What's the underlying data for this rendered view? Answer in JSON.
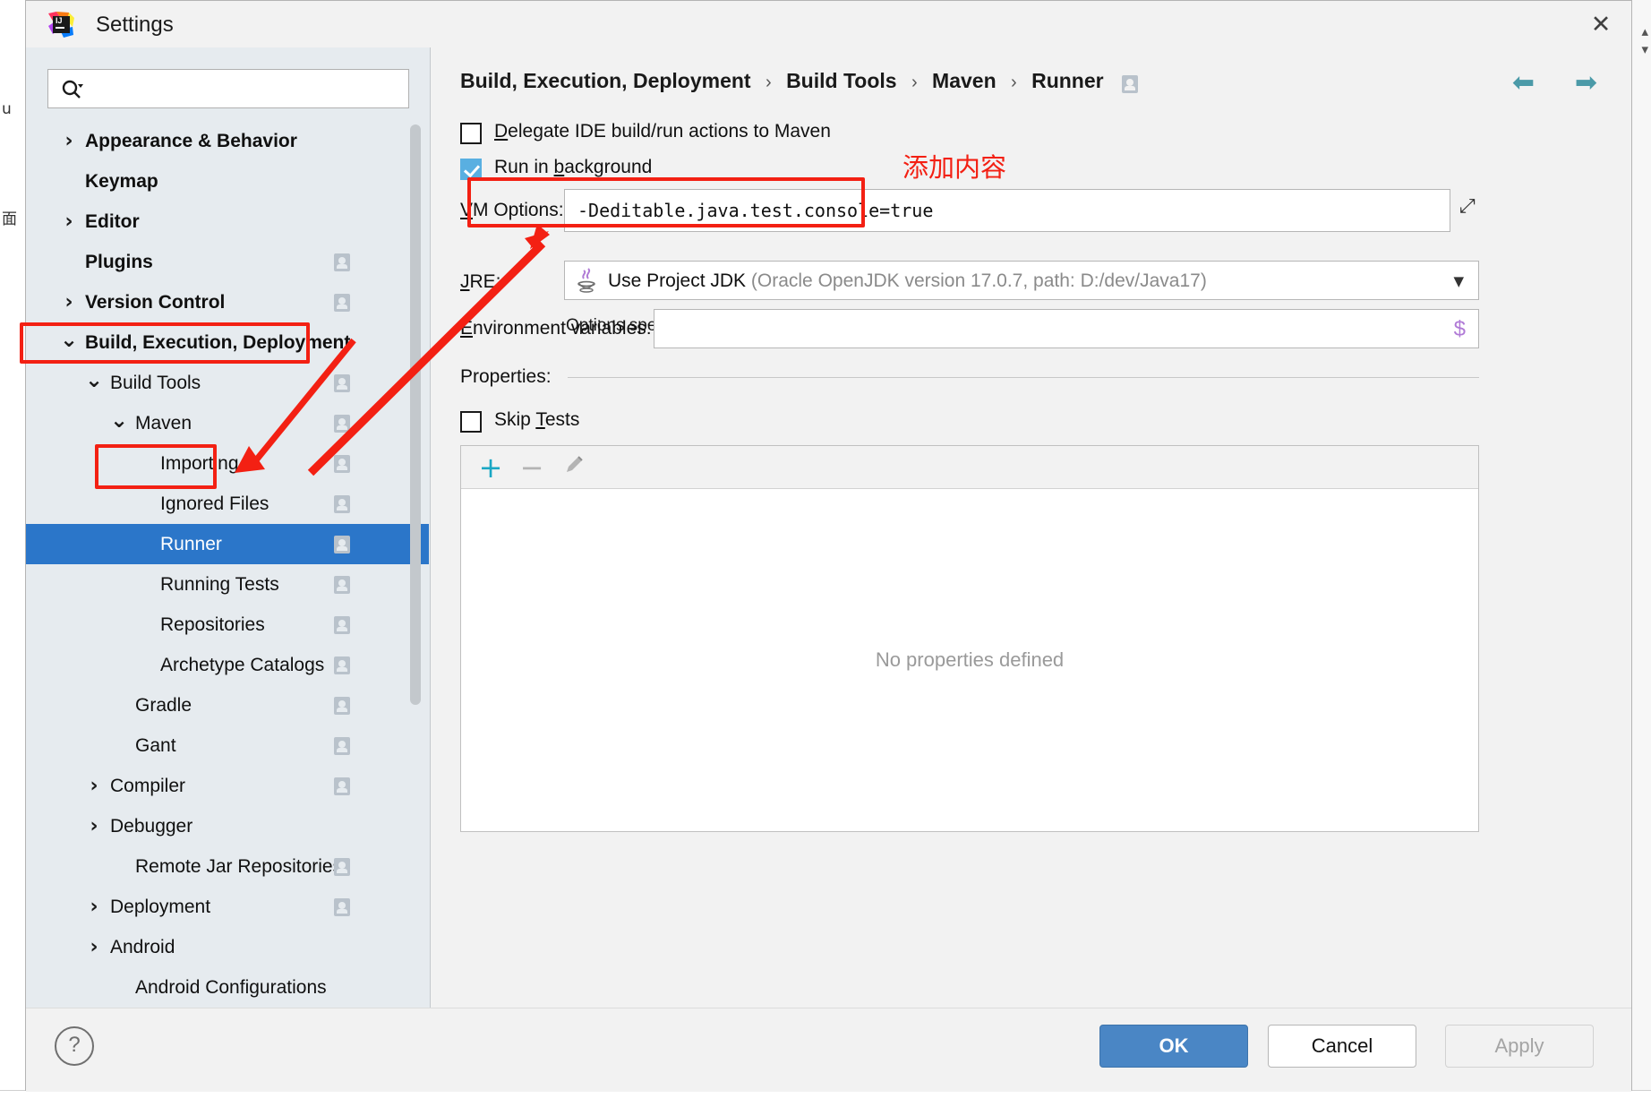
{
  "window": {
    "title": "Settings",
    "logo_icon": "intellij-idea-logo",
    "close_icon": "close-icon"
  },
  "sidebar": {
    "search": {
      "placeholder": "",
      "value": "",
      "icon": "search-icon"
    },
    "items": [
      {
        "label": "Appearance & Behavior",
        "indent": 0,
        "twisty": "collapsed",
        "bold": true,
        "badge": false,
        "selected": false
      },
      {
        "label": "Keymap",
        "indent": 0,
        "twisty": "none",
        "bold": true,
        "badge": false,
        "selected": false
      },
      {
        "label": "Editor",
        "indent": 0,
        "twisty": "collapsed",
        "bold": true,
        "badge": false,
        "selected": false
      },
      {
        "label": "Plugins",
        "indent": 0,
        "twisty": "none",
        "bold": true,
        "badge": true,
        "selected": false
      },
      {
        "label": "Version Control",
        "indent": 0,
        "twisty": "collapsed",
        "bold": true,
        "badge": true,
        "selected": false
      },
      {
        "label": "Build, Execution, Deployment",
        "indent": 0,
        "twisty": "expanded",
        "bold": true,
        "badge": false,
        "selected": false
      },
      {
        "label": "Build Tools",
        "indent": 1,
        "twisty": "expanded",
        "bold": false,
        "badge": true,
        "selected": false
      },
      {
        "label": "Maven",
        "indent": 2,
        "twisty": "expanded",
        "bold": false,
        "badge": true,
        "selected": false
      },
      {
        "label": "Importing",
        "indent": 3,
        "twisty": "none",
        "bold": false,
        "badge": true,
        "selected": false
      },
      {
        "label": "Ignored Files",
        "indent": 3,
        "twisty": "none",
        "bold": false,
        "badge": true,
        "selected": false
      },
      {
        "label": "Runner",
        "indent": 3,
        "twisty": "none",
        "bold": false,
        "badge": true,
        "selected": true
      },
      {
        "label": "Running Tests",
        "indent": 3,
        "twisty": "none",
        "bold": false,
        "badge": true,
        "selected": false
      },
      {
        "label": "Repositories",
        "indent": 3,
        "twisty": "none",
        "bold": false,
        "badge": true,
        "selected": false
      },
      {
        "label": "Archetype Catalogs",
        "indent": 3,
        "twisty": "none",
        "bold": false,
        "badge": true,
        "selected": false
      },
      {
        "label": "Gradle",
        "indent": 2,
        "twisty": "none",
        "bold": false,
        "badge": true,
        "selected": false
      },
      {
        "label": "Gant",
        "indent": 2,
        "twisty": "none",
        "bold": false,
        "badge": true,
        "selected": false
      },
      {
        "label": "Compiler",
        "indent": 1,
        "twisty": "collapsed",
        "bold": false,
        "badge": true,
        "selected": false
      },
      {
        "label": "Debugger",
        "indent": 1,
        "twisty": "collapsed",
        "bold": false,
        "badge": false,
        "selected": false
      },
      {
        "label": "Remote Jar Repositories",
        "indent": 2,
        "twisty": "none",
        "bold": false,
        "badge": true,
        "selected": false
      },
      {
        "label": "Deployment",
        "indent": 1,
        "twisty": "collapsed",
        "bold": false,
        "badge": true,
        "selected": false
      },
      {
        "label": "Android",
        "indent": 1,
        "twisty": "collapsed",
        "bold": false,
        "badge": false,
        "selected": false
      },
      {
        "label": "Android Configurations",
        "indent": 2,
        "twisty": "none",
        "bold": false,
        "badge": false,
        "selected": false
      }
    ]
  },
  "breadcrumb": {
    "parts": [
      "Build, Execution, Deployment",
      "Build Tools",
      "Maven",
      "Runner"
    ],
    "separator": "›",
    "badge_icon": "project-scope-badge-icon",
    "back_icon": "arrow-left-icon",
    "forward_icon": "arrow-right-icon"
  },
  "form": {
    "delegate": {
      "label": "Delegate IDE build/run actions to Maven",
      "checked": false
    },
    "run_in_background": {
      "label": "Run in background",
      "checked": true
    },
    "vm_options": {
      "label": "VM Options:",
      "value": "-Deditable.java.test.console=true",
      "expand_icon": "expand-editor-icon"
    },
    "vm_hint": "Options specified in this field override the ones in .mvn/jvm.config files",
    "jre": {
      "label": "JRE:",
      "icon": "java-duke-icon",
      "value": "Use Project JDK",
      "detail": "(Oracle OpenJDK version 17.0.7, path: D:/dev/Java17)",
      "chevron_icon": "chevron-down-icon"
    },
    "env_vars": {
      "label": "Environment variables:",
      "value": "",
      "macro_icon": "insert-macro-icon",
      "macro_glyph": "$"
    },
    "properties_section_label": "Properties:",
    "skip_tests": {
      "label": "Skip Tests",
      "checked": false
    },
    "properties_toolbar": {
      "add_icon": "plus-icon",
      "remove_icon": "minus-icon",
      "edit_icon": "pencil-icon"
    },
    "properties_empty_text": "No properties defined"
  },
  "footer": {
    "help_icon": "help-question-icon",
    "help_glyph": "?",
    "ok": "OK",
    "cancel": "Cancel",
    "apply": "Apply"
  },
  "annotations": {
    "add_content_label": "添加内容",
    "highlight_color": "#f32013"
  },
  "behind_window": {
    "left_glyphs": [
      "u",
      "面"
    ],
    "right_glyphs": [
      "▴",
      "▾"
    ]
  }
}
